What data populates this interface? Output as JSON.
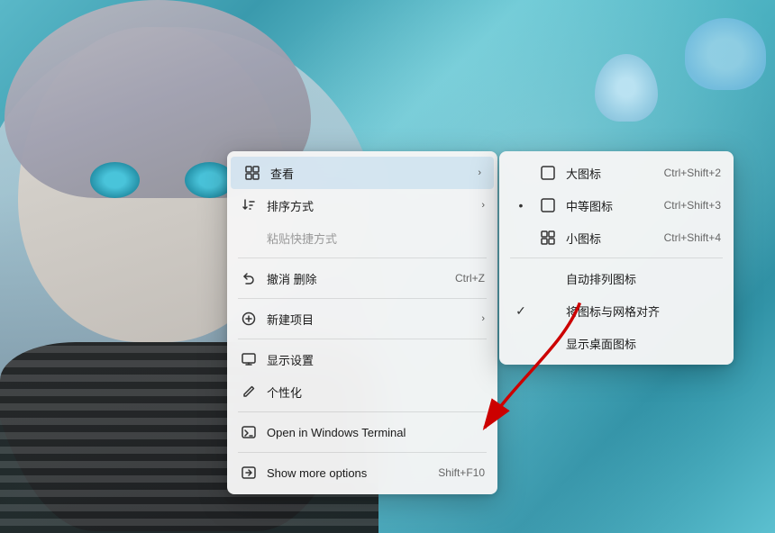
{
  "background": {
    "description": "Anime desktop wallpaper with teal/cyan character"
  },
  "contextMenu": {
    "items": [
      {
        "id": "view",
        "icon": "⊞",
        "label": "查看",
        "shortcut": "",
        "hasArrow": true,
        "type": "item",
        "highlighted": true
      },
      {
        "id": "sort",
        "icon": "↑",
        "label": "排序方式",
        "shortcut": "",
        "hasArrow": true,
        "type": "item"
      },
      {
        "id": "paste-shortcut",
        "label": "粘贴快捷方式",
        "type": "disabled"
      },
      {
        "id": "divider1",
        "type": "divider"
      },
      {
        "id": "undo",
        "icon": "↺",
        "label": "撤消 删除",
        "shortcut": "Ctrl+Z",
        "type": "item"
      },
      {
        "id": "divider2",
        "type": "divider"
      },
      {
        "id": "new",
        "icon": "⊕",
        "label": "新建项目",
        "shortcut": "",
        "hasArrow": true,
        "type": "item"
      },
      {
        "id": "divider3",
        "type": "divider"
      },
      {
        "id": "display",
        "icon": "🖥",
        "label": "显示设置",
        "type": "item"
      },
      {
        "id": "personalize",
        "icon": "✏",
        "label": "个性化",
        "type": "item"
      },
      {
        "id": "divider4",
        "type": "divider"
      },
      {
        "id": "terminal",
        "icon": "▶",
        "label": "Open in Windows Terminal",
        "type": "item"
      },
      {
        "id": "divider5",
        "type": "divider"
      },
      {
        "id": "more-options",
        "icon": "⊡",
        "label": "Show more options",
        "shortcut": "Shift+F10",
        "type": "item"
      }
    ]
  },
  "submenu": {
    "items": [
      {
        "id": "large-icon",
        "icon": "☐",
        "label": "大图标",
        "shortcut": "Ctrl+Shift+2",
        "checked": false
      },
      {
        "id": "medium-icon",
        "icon": "☐",
        "label": "中等图标",
        "shortcut": "Ctrl+Shift+3",
        "checked": false,
        "bulleted": true
      },
      {
        "id": "small-icon",
        "icon": "⊞",
        "label": "小图标",
        "shortcut": "Ctrl+Shift+4",
        "checked": false
      },
      {
        "id": "divider",
        "type": "divider"
      },
      {
        "id": "auto-arrange",
        "label": "自动排列图标",
        "checked": false
      },
      {
        "id": "align-grid",
        "label": "将图标与网格对齐",
        "checked": true
      },
      {
        "id": "show-desktop",
        "label": "显示桌面图标",
        "checked": false
      }
    ]
  }
}
